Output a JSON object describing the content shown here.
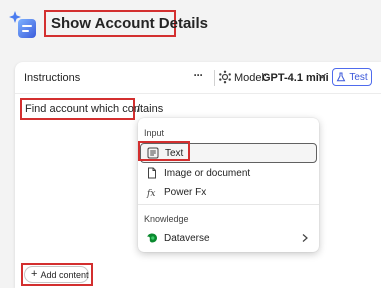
{
  "agent": {
    "title": "Show Account Details",
    "icon": "sparkle-agent-icon"
  },
  "instructions": {
    "title": "Instructions",
    "more_label": "···",
    "model_label": "Model:",
    "model_value": "GPT-4.1 mini",
    "test_label": "Test",
    "prompt_text": "Find account which contains",
    "slash": "/",
    "add_content_label": "Add content"
  },
  "menu": {
    "input_section": "Input",
    "items": [
      {
        "label": "Text",
        "icon": "text-icon",
        "selected": true
      },
      {
        "label": "Image or document",
        "icon": "document-icon"
      },
      {
        "label": "Power Fx",
        "icon": "fx-icon"
      }
    ],
    "knowledge_section": "Knowledge",
    "knowledge_items": [
      {
        "label": "Dataverse",
        "icon": "dataverse-icon",
        "has_submenu": true
      }
    ]
  },
  "colors": {
    "accent": "#4f6bed",
    "annotation": "#d32f2f"
  }
}
